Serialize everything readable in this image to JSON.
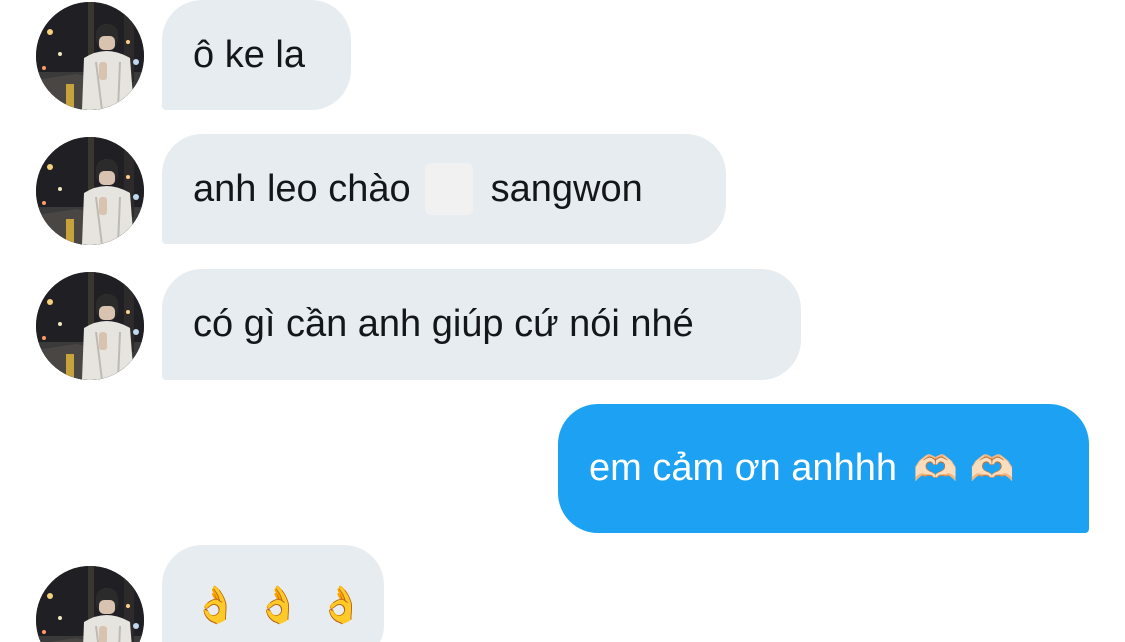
{
  "messages": [
    {
      "sender": "other",
      "text": "ô ke la"
    },
    {
      "sender": "other",
      "text_before": "anh leo chào",
      "text_after": "sangwon"
    },
    {
      "sender": "other",
      "text": "có gì cần anh giúp cứ nói nhé"
    },
    {
      "sender": "self",
      "text": "em cảm ơn anhhh",
      "emojis": [
        "🫶🏻",
        "🫶🏻"
      ]
    },
    {
      "sender": "other",
      "emojis": [
        "👌",
        "👌",
        "👌"
      ]
    }
  ],
  "colors": {
    "incoming_bubble": "#e6ecf0",
    "outgoing_bubble": "#1da1f2",
    "incoming_text": "#14171a",
    "outgoing_text": "#ffffff"
  },
  "icons": {
    "avatar": "user-avatar-photo",
    "heart_hands": "heart-hands-emoji",
    "ok_hand": "ok-hand-emoji"
  }
}
